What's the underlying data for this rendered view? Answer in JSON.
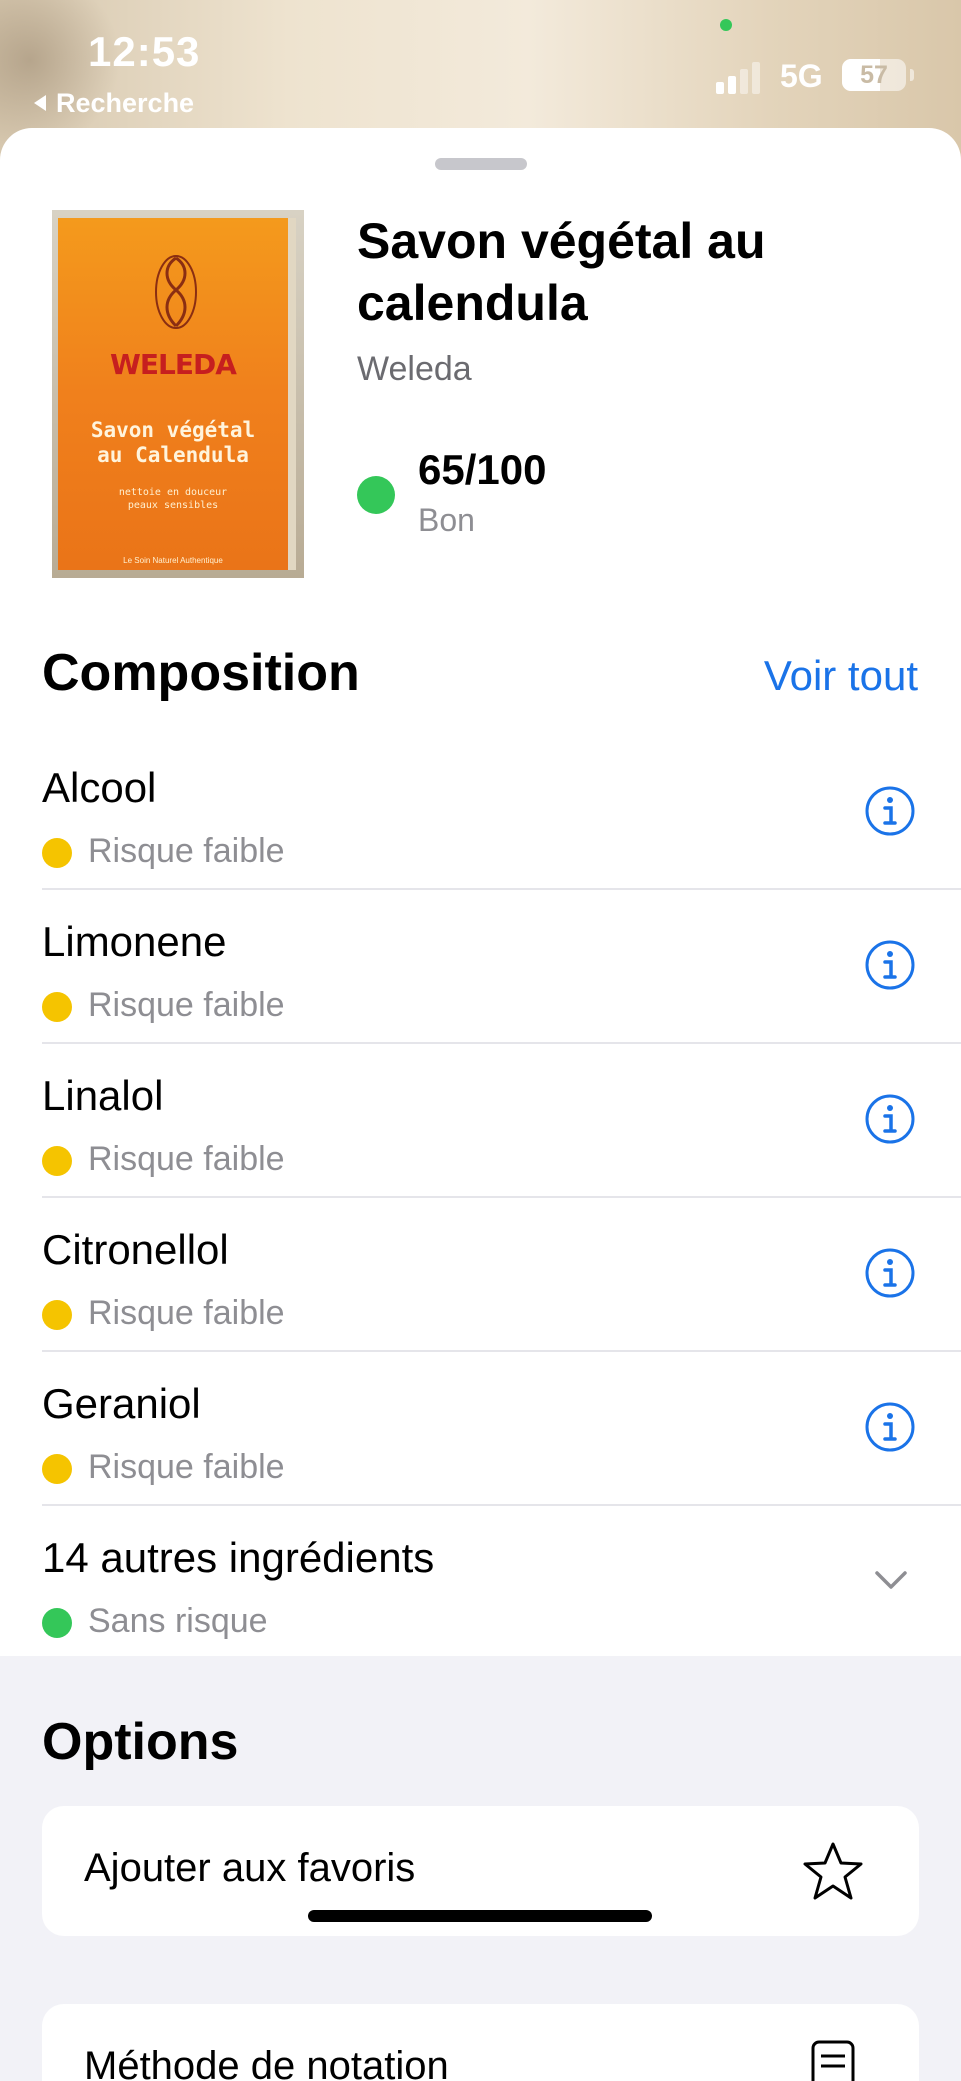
{
  "status_bar": {
    "time": "12:53",
    "back_label": "Recherche",
    "network": "5G",
    "battery": "57",
    "battery_level": 0.57
  },
  "product": {
    "name": "Savon végétal au calendula",
    "brand": "Weleda",
    "score": "65/100",
    "rating": "Bon",
    "score_color": "#34c759",
    "image": {
      "brand_text": "WELEDA",
      "title_lines": [
        "Savon végétal",
        "au Calendula"
      ],
      "subtitle_lines": [
        "nettoie en douceur",
        "peaux sensibles"
      ],
      "footer": "Le Soin Naturel Authentique"
    }
  },
  "composition": {
    "title": "Composition",
    "see_all": "Voir tout",
    "items": [
      {
        "name": "Alcool",
        "risk": "Risque faible",
        "color": "#f5c400",
        "icon": "info-icon"
      },
      {
        "name": "Limonene",
        "risk": "Risque faible",
        "color": "#f5c400",
        "icon": "info-icon"
      },
      {
        "name": "Linalol",
        "risk": "Risque faible",
        "color": "#f5c400",
        "icon": "info-icon"
      },
      {
        "name": "Citronellol",
        "risk": "Risque faible",
        "color": "#f5c400",
        "icon": "info-icon"
      },
      {
        "name": "Geraniol",
        "risk": "Risque faible",
        "color": "#f5c400",
        "icon": "info-icon"
      },
      {
        "name": "14 autres ingrédients",
        "risk": "Sans risque",
        "color": "#34c759",
        "icon": "chevron-down-icon"
      }
    ]
  },
  "options": {
    "title": "Options",
    "favorite_label": "Ajouter aux favoris",
    "method_label": "Méthode de notation"
  },
  "colors": {
    "accent": "#1a73e8",
    "low_risk": "#f5c400",
    "no_risk": "#34c759"
  }
}
